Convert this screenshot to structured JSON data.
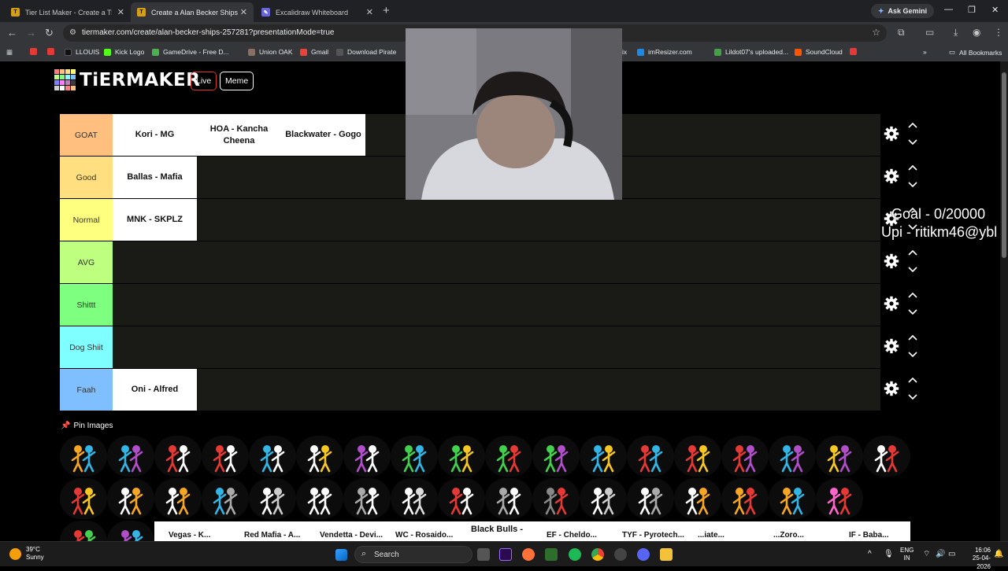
{
  "browser": {
    "tabs": [
      {
        "title": "Tier List Maker - Create a Tier L",
        "active": false
      },
      {
        "title": "Create a Alan Becker Ships Tier",
        "active": true
      },
      {
        "title": "Excalidraw Whiteboard",
        "active": false
      }
    ],
    "ask_gemini": "Ask Gemini",
    "url": "tiermaker.com/create/alan-becker-ships-257281?presentationMode=true",
    "bookmarks": [
      {
        "label": "",
        "color": "#e53935"
      },
      {
        "label": "",
        "color": "#e53935"
      },
      {
        "label": "LLOUIS",
        "color": "#222222"
      },
      {
        "label": "Kick Logo",
        "color": "#53fc18"
      },
      {
        "label": "GameDrive - Free D...",
        "color": "#4caf50"
      },
      {
        "label": "Union OAK",
        "color": "#8d6e63"
      },
      {
        "label": "Gmail",
        "color": "#ea4335"
      },
      {
        "label": "Download Pirate",
        "color": "#555555"
      },
      {
        "label": "ix",
        "color": "#888888"
      },
      {
        "label": "imResizer.com",
        "color": "#1e88e5"
      },
      {
        "label": "Lildot07's uploaded...",
        "color": "#43a047"
      },
      {
        "label": "SoundCloud",
        "color": "#ff5500"
      },
      {
        "label": "",
        "color": "#e53935"
      }
    ],
    "all_bookmarks": "All Bookmarks"
  },
  "site": {
    "logo": "TiERMAKER",
    "nav": {
      "live": "Live",
      "meme": "Meme"
    }
  },
  "tiers": [
    {
      "label": "GOAT",
      "color": "#ffbf7f",
      "items": [
        "Kori - MG",
        "HOA - Kancha Cheena",
        "Blackwater - Gogo"
      ]
    },
    {
      "label": "Good",
      "color": "#ffdf7f",
      "items": [
        "Ballas - Mafia"
      ]
    },
    {
      "label": "Normal",
      "color": "#ffff7f",
      "items": [
        "MNK - SKPLZ"
      ]
    },
    {
      "label": "AVG",
      "color": "#bfff7f",
      "items": []
    },
    {
      "label": "Shittt",
      "color": "#7fff7f",
      "items": []
    },
    {
      "label": "Dog Shiit",
      "color": "#7fffff",
      "items": []
    },
    {
      "label": "Faah",
      "color": "#7fbfff",
      "items": [
        "Oni - Alfred"
      ]
    }
  ],
  "pin_images": "Pin Images",
  "bottom_strip": {
    "labels": [
      "Vegas - K...",
      "Red Mafia - A...",
      "Vendetta - Devi...",
      "WC - Rosaido...",
      "Black Bulls -",
      "EF - Cheldo...",
      "TYF - Pyrotech...",
      "...iate...",
      "...Zoro...",
      "IF - Baba..."
    ]
  },
  "overlay": {
    "goal": "Goal - 0/20000",
    "upi": "Upi - ritikm46@ybl"
  },
  "taskbar": {
    "temperature": "39°C",
    "weather": "Sunny",
    "search": "Search",
    "lang_top": "ENG",
    "lang_bottom": "IN",
    "time": "16:06",
    "date": "25-04-2026"
  }
}
